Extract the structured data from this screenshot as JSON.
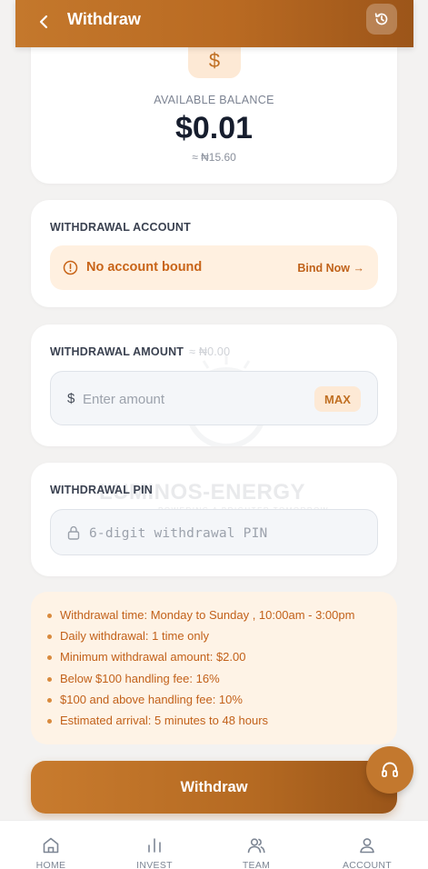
{
  "header": {
    "title": "Withdraw"
  },
  "balance": {
    "label": "AVAILABLE BALANCE",
    "value": "$0.01",
    "naira": "≈ ₦15.60",
    "icon_symbol": "$"
  },
  "account": {
    "title": "WITHDRAWAL ACCOUNT",
    "status": "No account bound",
    "bind_label": "Bind Now →"
  },
  "amount": {
    "title": "WITHDRAWAL AMOUNT",
    "hint": "≈ ₦0.00",
    "prefix": "$",
    "placeholder": "Enter amount",
    "max_label": "MAX"
  },
  "pin": {
    "title": "WITHDRAWAL PIN",
    "placeholder": "6-digit withdrawal PIN"
  },
  "watermark": {
    "brand": "LUMINOS-ENERGY",
    "tagline": "POWERING A BRIGHTER TOMORROW"
  },
  "rules": [
    "Withdrawal time: Monday to Sunday , 10:00am - 3:00pm",
    "Daily withdrawal: 1 time only",
    "Minimum withdrawal amount: $2.00",
    "Below $100 handling fee: 16%",
    "$100 and above handling fee: 10%",
    "Estimated arrival: 5 minutes to 48 hours"
  ],
  "submit_label": "Withdraw",
  "nav": [
    {
      "label": "HOME",
      "icon": "home-icon"
    },
    {
      "label": "INVEST",
      "icon": "bar-chart-icon"
    },
    {
      "label": "TEAM",
      "icon": "team-icon"
    },
    {
      "label": "ACCOUNT",
      "icon": "user-icon"
    }
  ],
  "colors": {
    "accent": "#b96a22",
    "accent_light": "#fde9d5",
    "notice_bg": "#fef3e6",
    "notice_text": "#c2611a"
  }
}
